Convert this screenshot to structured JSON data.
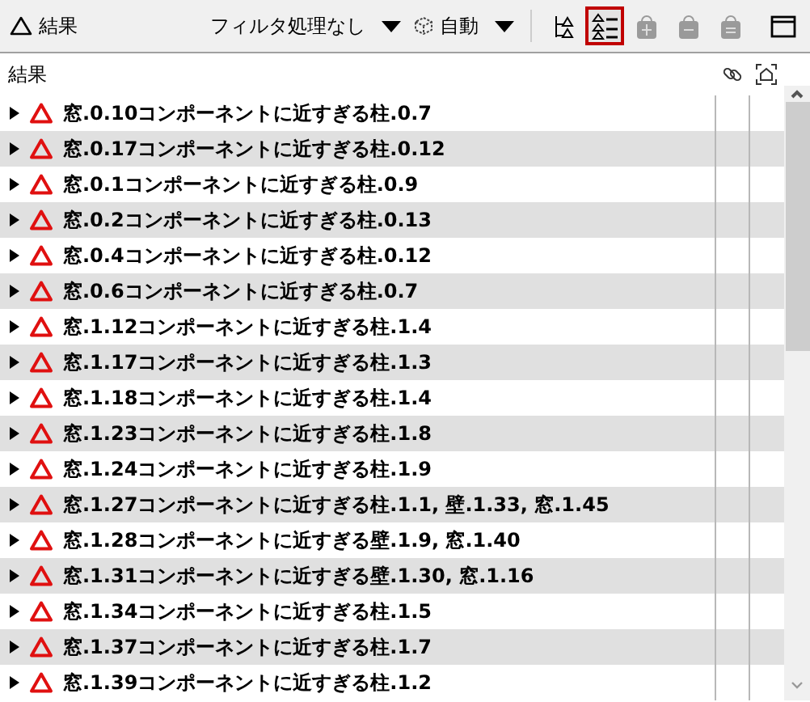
{
  "toolbar": {
    "title": "結果",
    "filter": {
      "value": "フィルタ処理なし"
    },
    "mode": {
      "value": "自動"
    },
    "tools": [
      {
        "kind": "tree",
        "selected": false,
        "disabled": false
      },
      {
        "kind": "list",
        "selected": true,
        "disabled": false
      },
      {
        "kind": "add",
        "selected": false,
        "disabled": true
      },
      {
        "kind": "remove",
        "selected": false,
        "disabled": true
      },
      {
        "kind": "bag",
        "selected": false,
        "disabled": true
      },
      {
        "kind": "window",
        "selected": false,
        "disabled": false
      }
    ]
  },
  "table": {
    "columns": [
      {
        "kind": "text",
        "label": "結果"
      },
      {
        "kind": "link"
      },
      {
        "kind": "focus"
      }
    ],
    "rows": [
      "窓.0.10コンポーネントに近すぎる柱.0.7",
      "窓.0.17コンポーネントに近すぎる柱.0.12",
      "窓.0.1コンポーネントに近すぎる柱.0.9",
      "窓.0.2コンポーネントに近すぎる柱.0.13",
      "窓.0.4コンポーネントに近すぎる柱.0.12",
      "窓.0.6コンポーネントに近すぎる柱.0.7",
      "窓.1.12コンポーネントに近すぎる柱.1.4",
      "窓.1.17コンポーネントに近すぎる柱.1.3",
      "窓.1.18コンポーネントに近すぎる柱.1.4",
      "窓.1.23コンポーネントに近すぎる柱.1.8",
      "窓.1.24コンポーネントに近すぎる柱.1.9",
      "窓.1.27コンポーネントに近すぎる柱.1.1, 壁.1.33, 窓.1.45",
      "窓.1.28コンポーネントに近すぎる壁.1.9, 窓.1.40",
      "窓.1.31コンポーネントに近すぎる壁.1.30, 窓.1.16",
      "窓.1.34コンポーネントに近すぎる柱.1.5",
      "窓.1.37コンポーネントに近すぎる柱.1.7",
      "窓.1.39コンポーネントに近すぎる柱.1.2"
    ]
  }
}
